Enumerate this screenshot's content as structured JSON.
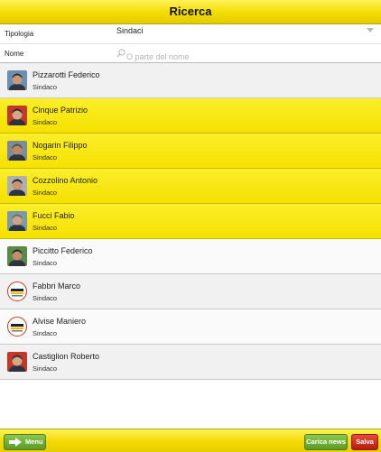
{
  "header": {
    "title": "Ricerca"
  },
  "filter": {
    "tipologia_label": "Tipologia",
    "tipologia_value": "Sindaci",
    "nome_label": "Nome",
    "nome_placeholder": "O parte del nome"
  },
  "people": [
    {
      "name": "Pizzarotti Federico",
      "role": "Sindaco",
      "highlighted": false,
      "avatar": "photo"
    },
    {
      "name": "Cinque Patrizio",
      "role": "Sindaco",
      "highlighted": true,
      "avatar": "photo"
    },
    {
      "name": "Nogarin Filippo",
      "role": "Sindaco",
      "highlighted": true,
      "avatar": "photo"
    },
    {
      "name": "Cozzolino Antonio",
      "role": "Sindaco",
      "highlighted": true,
      "avatar": "photo"
    },
    {
      "name": "Fucci Fabio",
      "role": "Sindaco",
      "highlighted": true,
      "avatar": "photo"
    },
    {
      "name": "Piccitto Federico",
      "role": "Sindaco",
      "highlighted": false,
      "avatar": "photo"
    },
    {
      "name": "Fabbri Marco",
      "role": "Sindaco",
      "highlighted": false,
      "avatar": "m5s-logo"
    },
    {
      "name": "Alvise Maniero",
      "role": "Sindaco",
      "highlighted": false,
      "avatar": "m5s-logo"
    },
    {
      "name": "Castiglion Roberto",
      "role": "Sindaco",
      "highlighted": false,
      "avatar": "photo"
    }
  ],
  "toolbar": {
    "menu_label": "Menu",
    "news_label": "Carica news",
    "save_label": "Salva"
  },
  "colors": {
    "accent_yellow": "#f6e100",
    "button_green": "#6aa830",
    "button_red": "#c8241a"
  }
}
